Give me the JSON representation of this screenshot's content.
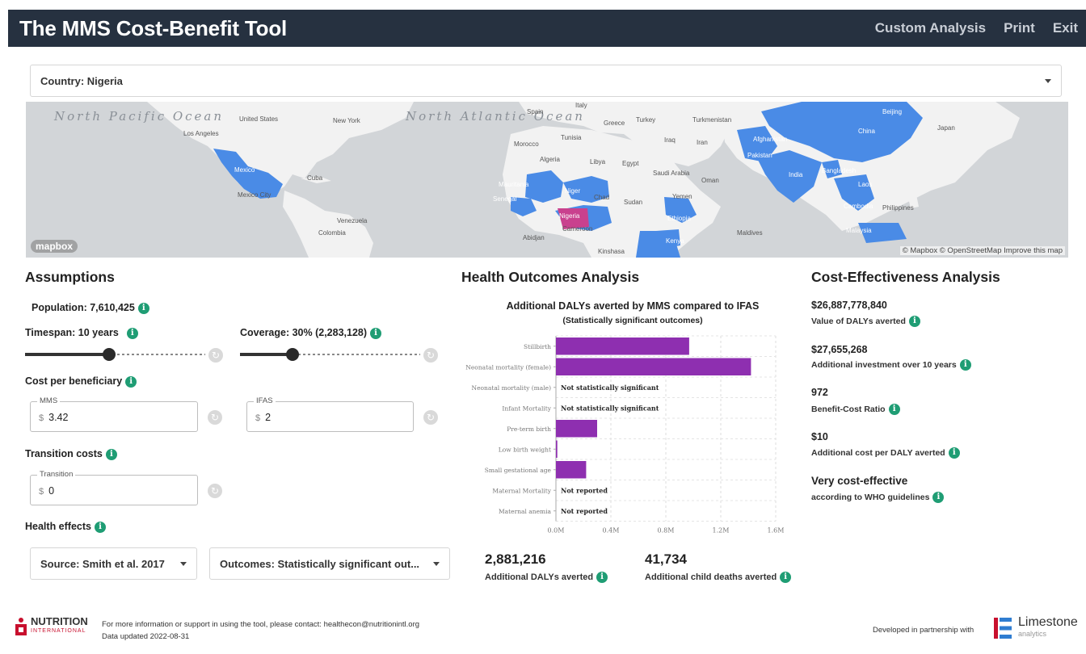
{
  "header": {
    "title": "The MMS Cost-Benefit Tool",
    "nav": [
      "Custom Analysis",
      "Print",
      "Exit"
    ]
  },
  "country_select": {
    "label": "Country: Nigeria"
  },
  "map": {
    "oceans": [
      "North Pacific Ocean",
      "North Atlantic Ocean"
    ],
    "labels": {
      "united_states": "United States",
      "new_york": "New York",
      "los_angeles": "Los Angeles",
      "mexico": "Mexico",
      "mexico_city": "Mexico City",
      "cuba": "Cuba",
      "venezuela": "Venezuela",
      "colombia": "Colombia",
      "spain": "Spain",
      "italy": "Italy",
      "greece": "Greece",
      "turkey": "Turkey",
      "turkmenistan": "Turkmenistan",
      "morocco": "Morocco",
      "tunisia": "Tunisia",
      "iraq": "Iraq",
      "iran": "Iran",
      "algeria": "Algeria",
      "libya": "Libya",
      "egypt": "Egypt",
      "saudi_arabia": "Saudi Arabia",
      "oman": "Oman",
      "yemen": "Yemen",
      "mauritania": "Mauritania",
      "niger": "Niger",
      "chad": "Chad",
      "sudan": "Sudan",
      "senegal": "Senegal",
      "nigeria": "Nigeria",
      "ethiopia": "Ethiopia",
      "cameroon": "Cameroon",
      "abidjan": "Abidjan",
      "kenya": "Kenya",
      "kinshasa": "Kinshasa",
      "afghanistan": "Afghanistan",
      "pakistan": "Pakistan",
      "india": "India",
      "bangladesh": "Bangladesh",
      "laos": "Laos",
      "cambodia": "Cambodia",
      "philippines": "Philippines",
      "malaysia": "Malaysia",
      "maldives": "Maldives",
      "china": "China",
      "beijing": "Beijing",
      "japan": "Japan"
    },
    "logo": "mapbox",
    "attribution": "© Mapbox © OpenStreetMap  Improve this map",
    "colors": {
      "land": "#f2f2f2",
      "water": "#d2d5d8",
      "highlight": "#4a8be6",
      "selected": "#c9418e"
    }
  },
  "assumptions": {
    "title": "Assumptions",
    "population": "Population: 7,610,425",
    "timespan": {
      "label": "Timespan: 10 years",
      "value": 10,
      "min": 1,
      "max": 30
    },
    "coverage": {
      "label": "Coverage: 30% (2,283,128)",
      "value": 30,
      "min": 0,
      "max": 100
    },
    "cost_per_beneficiary": "Cost per beneficiary",
    "mms": {
      "legend": "MMS",
      "currency": "$",
      "value": "3.42"
    },
    "ifas": {
      "legend": "IFAS",
      "currency": "$",
      "value": "2"
    },
    "transition_costs": "Transition costs",
    "transition": {
      "legend": "Transition",
      "currency": "$",
      "value": "0"
    },
    "health_effects": "Health effects",
    "source": "Source: Smith et al. 2017",
    "outcomes": "Outcomes: Statistically significant out..."
  },
  "health": {
    "title": "Health Outcomes Analysis",
    "chart_title": "Additional DALYs averted by MMS compared to IFAS",
    "chart_subtitle": "(Statistically significant outcomes)",
    "dalys_value": "2,881,216",
    "dalys_label": "Additional DALYs averted",
    "deaths_value": "41,734",
    "deaths_label": "Additional child deaths averted"
  },
  "chart_data": {
    "type": "bar",
    "orientation": "horizontal",
    "title": "Additional DALYs averted by MMS compared to IFAS",
    "subtitle": "(Statistically significant outcomes)",
    "categories": [
      "Stillbirth",
      "Neonatal mortality (female)",
      "Neonatal mortality (male)",
      "Infant Mortality",
      "Pre-term birth",
      "Low birth weight",
      "Small gestational age",
      "Maternal Mortality",
      "Maternal anemia"
    ],
    "values": [
      0.97,
      1.42,
      null,
      null,
      0.3,
      0.01,
      0.22,
      null,
      null
    ],
    "annotations": [
      "",
      "",
      "Not statistically significant",
      "Not statistically significant",
      "",
      "",
      "",
      "Not reported",
      "Not reported"
    ],
    "x_ticks": [
      "0.0M",
      "0.4M",
      "0.8M",
      "1.2M",
      "1.6M"
    ],
    "xlim": [
      0,
      1.6
    ],
    "grid": true,
    "color": "#8e2fb0"
  },
  "cost_effectiveness": {
    "title": "Cost-Effectiveness Analysis",
    "items": [
      {
        "value": "$26,887,778,840",
        "label": "Value of DALYs averted"
      },
      {
        "value": "$27,655,268",
        "label": "Additional investment over 10 years"
      },
      {
        "value": "972",
        "label": "Benefit-Cost Ratio"
      },
      {
        "value": "$10",
        "label": "Additional cost per DALY averted"
      },
      {
        "value": "Very cost-effective",
        "label": "according to WHO guidelines"
      }
    ]
  },
  "footer": {
    "org": "NUTRITION",
    "org_sub": "INTERNATIONAL",
    "contact": "For more information or support in using the tool, please contact: healthecon@nutritionintl.org",
    "updated": "Data updated 2022-08-31",
    "partner_text": "Developed in partnership with",
    "partner_name": "Limestone",
    "partner_sub": "analytics"
  },
  "icons": {
    "info": "info-icon",
    "reset": "reset-icon",
    "caret": "chevron-down-icon"
  }
}
